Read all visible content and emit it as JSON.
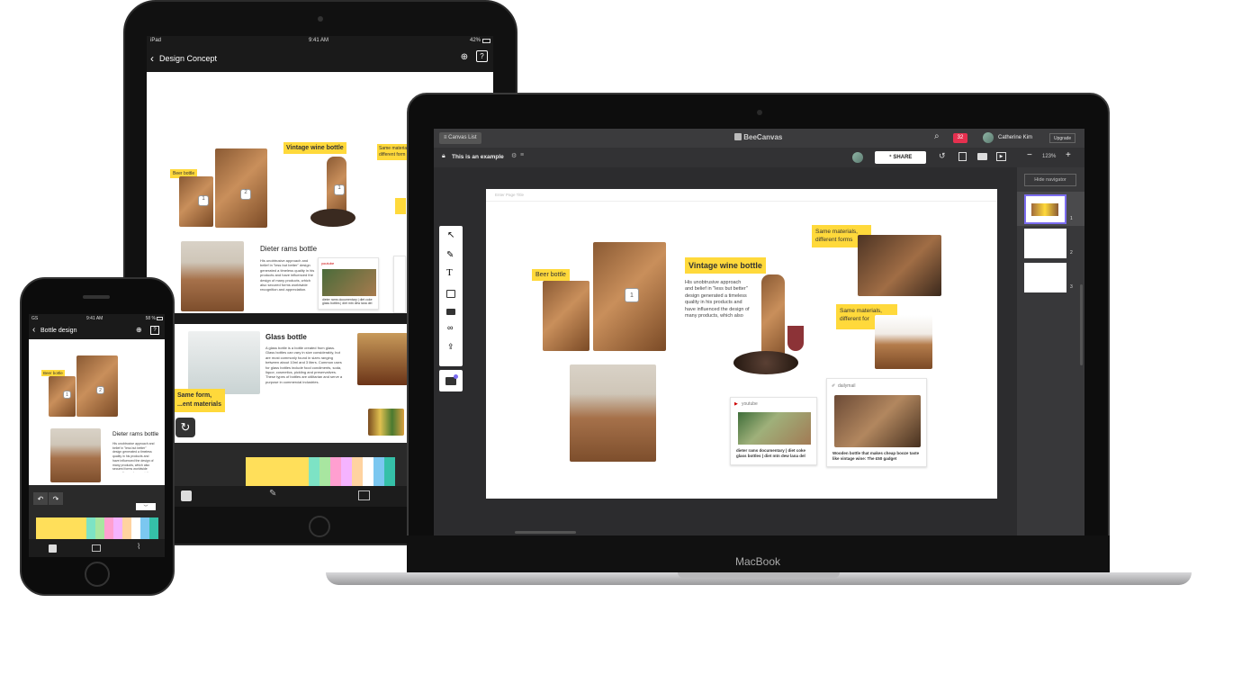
{
  "ipad": {
    "status": {
      "carrier": "iPad",
      "time": "9:41 AM",
      "battery": "42%"
    },
    "title": "Design Concept",
    "tags": {
      "beer": "Beer bottle",
      "vintage": "Vintage wine bottle",
      "same": "Same material",
      "different": "different form",
      "same_form": "Same form,",
      "same_form2": "...ent materials"
    },
    "badges": {
      "one": "1",
      "two": "2",
      "three": "1"
    },
    "dieter_title": "Dieter rams bottle",
    "dieter_text": "His unobtrusive approach and belief in \"less but better\" design generated a timeless quality in his products and have influenced the design of many products, which also secured forms worldwide recognition and appreciation.",
    "youtube_label": "youtube",
    "youtube_caption": "dieter rams documentary | diet coke glass bottles | diet mtn dew lana del",
    "glass_title": "Glass bottle",
    "glass_text": "A glass bottle is a bottle created from glass. Glass bottles can vary in size considerably, but are most commonly found in sizes ranging between about 10ml and 3 liters. Common uses for glass bottles include food condiments, soda, liquor, cosmetics, pickling and preservatives. These types of bottles are utilitarian and serve a purpose in commercial industries.",
    "toolbar_icons": [
      "note-icon",
      "pen-icon",
      "image-icon"
    ],
    "palette": [
      "#ffdf5a",
      "#7de3c5",
      "#a8e6a0",
      "#ff9fd0",
      "#f5b3ff",
      "#ffd3a0",
      "#ffffff",
      "#7bc7f0",
      "#35c0a8"
    ]
  },
  "laptop": {
    "brand": "MacBook",
    "topbar": {
      "canvas_list": "Canvas List",
      "logo": "BeeCanvas",
      "notif": "32",
      "user": "Catherine Kim",
      "upgrade": "Upgrade"
    },
    "subbar": {
      "canvas_name": "This is an example",
      "share": "SHARE",
      "zoom": "123%"
    },
    "hide_navigator": "Hide navigator",
    "page_title_placeholder": "Enter Page Title",
    "pages": [
      "1",
      "2",
      "3"
    ],
    "canvas": {
      "beer_tag": "Beer bottle",
      "badge": "1",
      "vintage_tag": "Vintage wine bottle",
      "vintage_text": "His unobtrusive approach and belief in \"less but better\" design generated a timeless quality in his products and have influenced the design of many products, which also",
      "same_tag": "Same materials, different forms",
      "same_tag2": "Same materials, different for",
      "youtube_label": "youtube",
      "youtube_caption": "dieter rams documentary | diet coke glass bottles | diet mtn dew lana del",
      "dailymail_label": "dailymail",
      "dailymail_caption": "Wooden bottle that makes cheap booze taste like vintage wine: The £50 gadget"
    }
  },
  "phone": {
    "status": {
      "carrier": "GS",
      "time": "9:41 AM",
      "battery": "58 %"
    },
    "title": "Bottle design",
    "beer_tag": "Beer bottle",
    "badge1": "1",
    "badge2": "2",
    "dieter_title": "Dieter rams bottle",
    "dieter_text": "His unobtrusive approach and belief in \"less but better\" design generated a timeless quality in his products and have influenced the design of many products, which also secured forms worldwide recognition and appreciation.",
    "palette": [
      "#ffdf5a",
      "#7de3c5",
      "#a8e6a0",
      "#ff9fd0",
      "#f5b3ff",
      "#ffd3a0",
      "#ffffff",
      "#7bc7f0",
      "#35c0a8"
    ]
  }
}
